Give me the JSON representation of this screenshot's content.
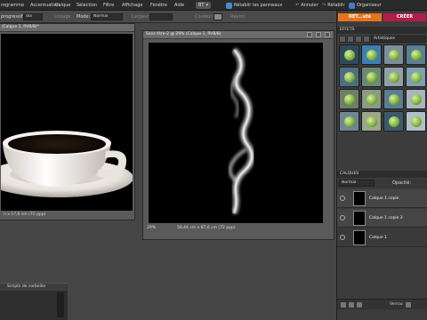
{
  "menubar": {
    "items": [
      "rogramme",
      "Accentuation",
      "Calque",
      "Sélection",
      "Filtre",
      "Affichage",
      "Fenêtre",
      "Aide"
    ],
    "workspace_badge": "BT",
    "reset_panels": "Rétablir les panneaux",
    "undo": "Annuler",
    "redo": "Rétablir",
    "organizer": "Organiseur"
  },
  "options": {
    "brush_label": "progressif:",
    "brush_value": "dia",
    "smoothing": "Lissage",
    "mode_label": "Mode:",
    "mode_value": "Normal",
    "width_label": "Largeur:",
    "color_label": "Couleur:",
    "radius_label": "Rayon:"
  },
  "doc_left": {
    "title": "/Calque 1, RVB/8)*",
    "status": "n x 17,6 cm (72 ppp)"
  },
  "doc_right": {
    "title": "Sans titre-2 @ 29% (Calque 1, RVB/8)",
    "zoom": "29%",
    "status": "56,44 cm x 87,6 cm (72 ppp)"
  },
  "bin": {
    "title": "Scripts de corbeille"
  },
  "right_panel": {
    "tab_edit": "RET...uté",
    "tab_create": "CRÉER",
    "effects_title": "EFFETS",
    "effects_filter": "Artistiques",
    "layers_title": "CALQUES",
    "blend_mode": "Normal",
    "opacity_label": "Opacité:",
    "layers": [
      {
        "name": "Calque 1 copie"
      },
      {
        "name": "Calque 1 copie 2"
      },
      {
        "name": "Calque 1"
      }
    ],
    "lock_label": "Verrou"
  },
  "colors": {
    "edit_tab": "#e8731e",
    "create_tab": "#b01e48",
    "canvas": "#000000"
  },
  "icons": [
    "undo-icon",
    "redo-icon",
    "organizer-icon",
    "eye-icon",
    "new-layer-icon",
    "trash-icon",
    "lock-icon"
  ]
}
